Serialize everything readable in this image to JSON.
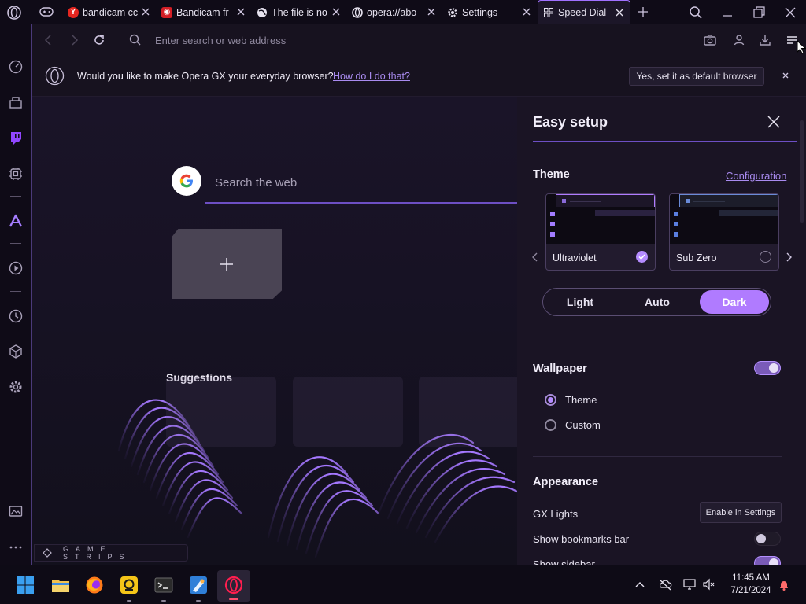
{
  "tabs": [
    {
      "title": "bandicam cc",
      "favicon": "yandex-icon",
      "color": "#e52620"
    },
    {
      "title": "Bandicam fr",
      "favicon": "bandicam-icon",
      "color": "#d41f26"
    },
    {
      "title": "The file is no",
      "favicon": "globe-icon",
      "color": "#cccccc"
    },
    {
      "title": "opera://abo",
      "favicon": "opera-icon",
      "color": "#cccccc"
    },
    {
      "title": "Settings",
      "favicon": "gear-icon",
      "color": "#cccccc"
    },
    {
      "title": "Speed Dial",
      "favicon": "grid-icon",
      "color": "#cccccc"
    }
  ],
  "address_bar": {
    "placeholder": "Enter search or web address"
  },
  "infobar": {
    "message": "Would you like to make Opera GX your everyday browser?",
    "link": "How do I do that?",
    "button": "Yes, set it as default browser"
  },
  "speed_dial": {
    "search_placeholder": "Search the web",
    "suggestions_label": "Suggestions",
    "game_strips_label": "GAME STRIPS"
  },
  "easy_setup": {
    "title": "Easy setup",
    "theme": {
      "heading": "Theme",
      "configuration_link": "Configuration",
      "cards": [
        {
          "name": "Ultraviolet",
          "selected": true
        },
        {
          "name": "Sub Zero",
          "selected": false
        }
      ],
      "modes": [
        "Light",
        "Auto",
        "Dark"
      ],
      "selected_mode": "Dark"
    },
    "wallpaper": {
      "heading": "Wallpaper",
      "enabled": true,
      "options": [
        {
          "label": "Theme",
          "selected": true
        },
        {
          "label": "Custom",
          "selected": false
        }
      ]
    },
    "appearance": {
      "heading": "Appearance",
      "gx_lights_label": "GX Lights",
      "gx_lights_button": "Enable in Settings",
      "bookmarks_bar_label": "Show bookmarks bar",
      "bookmarks_bar_on": false,
      "sidebar_label": "Show sidebar",
      "sidebar_on": true
    }
  },
  "taskbar": {
    "time": "11:45 AM",
    "date": "7/21/2024"
  },
  "colors": {
    "accent": "#b07bff",
    "accent_dark": "#6d4fc4",
    "background": "#120e1c"
  }
}
